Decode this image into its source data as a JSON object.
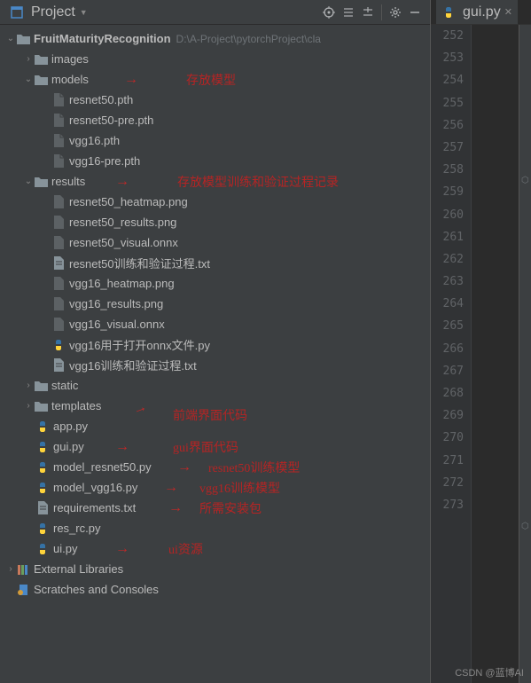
{
  "toolbar": {
    "project_label": "Project"
  },
  "tree": {
    "root": {
      "name": "FruitMaturityRecognition",
      "path": "D:\\A-Project\\pytorchProject\\cla"
    },
    "images": "images",
    "models": "models",
    "models_items": [
      "resnet50.pth",
      "resnet50-pre.pth",
      "vgg16.pth",
      "vgg16-pre.pth"
    ],
    "results": "results",
    "results_items": [
      "resnet50_heatmap.png",
      "resnet50_results.png",
      "resnet50_visual.onnx",
      "resnet50训练和验证过程.txt",
      "vgg16_heatmap.png",
      "vgg16_results.png",
      "vgg16_visual.onnx",
      "vgg16用于打开onnx文件.py",
      "vgg16训练和验证过程.txt"
    ],
    "static": "static",
    "templates": "templates",
    "files": [
      "app.py",
      "gui.py",
      "model_resnet50.py",
      "model_vgg16.py",
      "requirements.txt",
      "res_rc.py",
      "ui.py"
    ],
    "ext_lib": "External Libraries",
    "scratches": "Scratches and Consoles"
  },
  "annotations": {
    "models": "存放模型",
    "results": "存放模型训练和验证过程记录",
    "templates": "前端界面代码",
    "gui": "gui界面代码",
    "resnet": "resnet50训练模型",
    "vgg": "vgg16训练模型",
    "req": "所需安装包",
    "ui": "ui资源"
  },
  "editor": {
    "tab": "gui.py",
    "lines": [
      "252",
      "253",
      "254",
      "255",
      "256",
      "257",
      "258",
      "259",
      "260",
      "261",
      "262",
      "263",
      "264",
      "265",
      "266",
      "267",
      "268",
      "269",
      "270",
      "271",
      "272",
      "273"
    ]
  },
  "watermark": "CSDN @蓝博AI"
}
